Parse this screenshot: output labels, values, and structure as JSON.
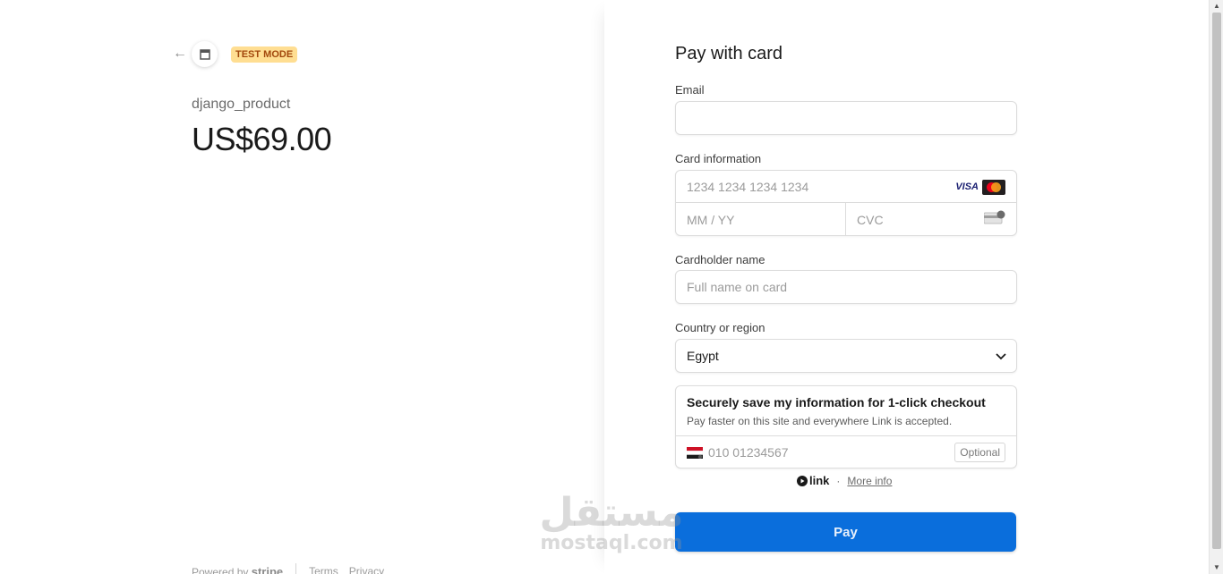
{
  "header": {
    "back_icon": "arrow-left-icon",
    "store_icon": "store-icon",
    "test_badge": "TEST MODE"
  },
  "product": {
    "name": "django_product",
    "price": "US$69.00"
  },
  "footer": {
    "powered_by": "Powered by",
    "brand": "stripe",
    "terms": "Terms",
    "privacy": "Privacy"
  },
  "form": {
    "title": "Pay with card",
    "email": {
      "label": "Email",
      "value": "",
      "placeholder": ""
    },
    "card": {
      "label": "Card information",
      "number_placeholder": "1234 1234 1234 1234",
      "expiry_placeholder": "MM / YY",
      "cvc_placeholder": "CVC",
      "brand_visa": "VISA",
      "brand_icons": [
        "visa-icon",
        "mastercard-icon"
      ]
    },
    "cardholder": {
      "label": "Cardholder name",
      "placeholder": "Full name on card"
    },
    "country": {
      "label": "Country or region",
      "value": "Egypt"
    },
    "link_save": {
      "title": "Securely save my information for 1-click checkout",
      "subtitle": "Pay faster on this site and everywhere Link is accepted.",
      "phone_placeholder": "010 01234567",
      "optional": "Optional"
    },
    "link_footer": {
      "logo": "link",
      "dot": "·",
      "more_info": "More info"
    },
    "pay_button": "Pay"
  },
  "watermark": {
    "arabic": "مستقل",
    "latin": "mostaql.com"
  },
  "colors": {
    "accent": "#0a6edc",
    "badge_bg": "#ffde92",
    "badge_text": "#a2470c"
  }
}
